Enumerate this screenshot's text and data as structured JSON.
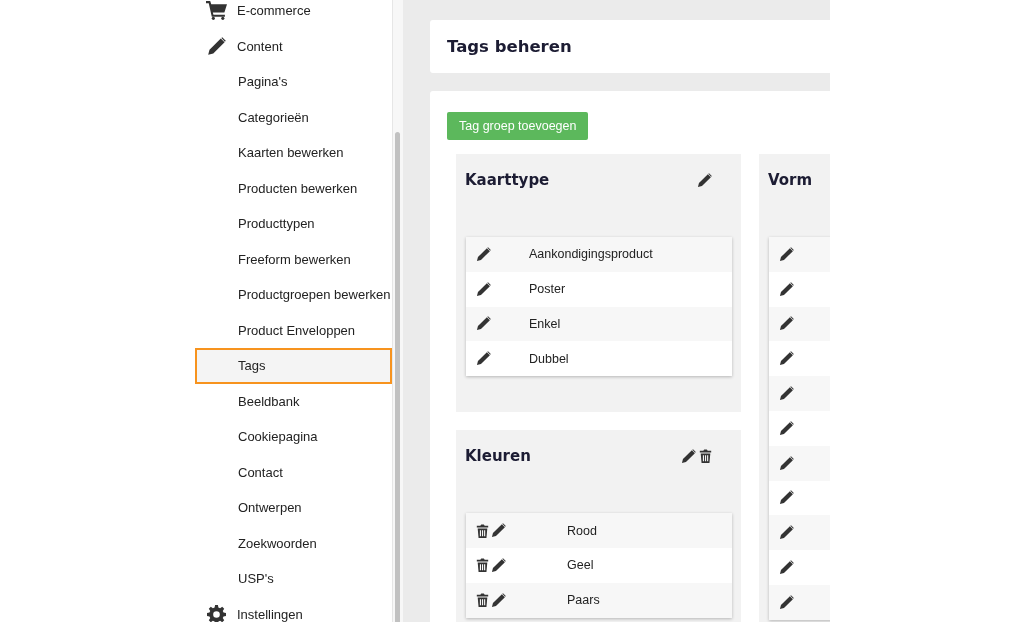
{
  "sidebar": {
    "items": [
      {
        "label": "E-commerce"
      },
      {
        "label": "Content",
        "children": [
          {
            "label": "Pagina's",
            "selected": false
          },
          {
            "label": "Categorieën",
            "selected": false
          },
          {
            "label": "Kaarten bewerken",
            "selected": false
          },
          {
            "label": "Producten bewerken",
            "selected": false
          },
          {
            "label": "Producttypen",
            "selected": false
          },
          {
            "label": "Freeform bewerken",
            "selected": false
          },
          {
            "label": "Productgroepen bewerken",
            "selected": false
          },
          {
            "label": "Product Enveloppen",
            "selected": false
          },
          {
            "label": "Tags",
            "selected": true
          },
          {
            "label": "Beeldbank",
            "selected": false
          },
          {
            "label": "Cookiepagina",
            "selected": false
          },
          {
            "label": "Contact",
            "selected": false
          },
          {
            "label": "Ontwerpen",
            "selected": false
          },
          {
            "label": "Zoekwoorden",
            "selected": false
          },
          {
            "label": "USP's",
            "selected": false
          }
        ]
      },
      {
        "label": "Instellingen"
      }
    ]
  },
  "page": {
    "title": "Tags beheren",
    "add_button": "Tag groep toevoegen",
    "columns": [
      [
        {
          "title": "Kaarttype",
          "kind": "editable",
          "tags": [
            {
              "label": "Aankondigingsproduct",
              "kind": "editable"
            },
            {
              "label": "Poster",
              "kind": "editable"
            },
            {
              "label": "Enkel",
              "kind": "editable"
            },
            {
              "label": "Dubbel",
              "kind": "editable"
            }
          ]
        },
        {
          "title": "Kleuren",
          "kind": "deletable",
          "tags": [
            {
              "label": "Rood",
              "kind": "deletable"
            },
            {
              "label": "Geel",
              "kind": "deletable"
            },
            {
              "label": "Paars",
              "kind": "deletable"
            }
          ]
        }
      ],
      [
        {
          "title": "Vorm",
          "tags": [
            {
              "kind": "editable"
            },
            {
              "kind": "editable"
            },
            {
              "kind": "editable"
            },
            {
              "kind": "editable"
            },
            {
              "kind": "editable"
            },
            {
              "kind": "editable"
            },
            {
              "kind": "editable"
            },
            {
              "kind": "editable"
            },
            {
              "kind": "editable"
            },
            {
              "kind": "editable"
            },
            {
              "kind": "editable"
            }
          ]
        }
      ]
    ]
  }
}
